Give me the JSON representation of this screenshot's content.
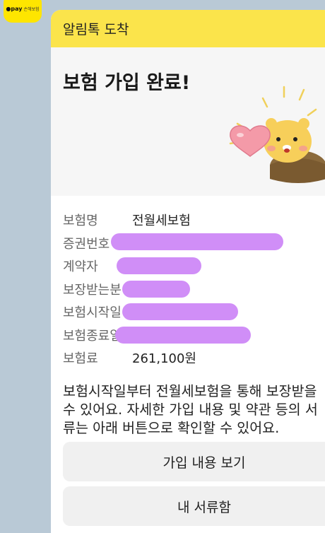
{
  "sender": {
    "logo_pay": "●pay",
    "logo_service": "손해보험"
  },
  "header": {
    "title": "알림톡 도착"
  },
  "hero": {
    "title": "보험 가입 완료!"
  },
  "details": [
    {
      "label": "보험명",
      "value": "전월세보험"
    },
    {
      "label": "증권번호",
      "value": ""
    },
    {
      "label": "계약자",
      "value": ""
    },
    {
      "label": "보장받는분",
      "value": ""
    },
    {
      "label": "보험시작일",
      "value": ""
    },
    {
      "label": "보험종료일",
      "value": ""
    },
    {
      "label": "보험료",
      "value": "261,100원"
    }
  ],
  "description": {
    "line1": "보험시작일부터 전월세보험을 통해 보장받을",
    "line2": "수 있어요. 자세한 가입 내용 및 약관 등의 서",
    "line3": "류는 아래 버튼으로 확인할 수 있어요."
  },
  "buttons": {
    "view_details": "가입 내용 보기",
    "my_documents": "내 서류함"
  },
  "colors": {
    "header_bg": "#fbe44b",
    "redaction": "#d08ef7",
    "background": "#b9c9d6"
  }
}
